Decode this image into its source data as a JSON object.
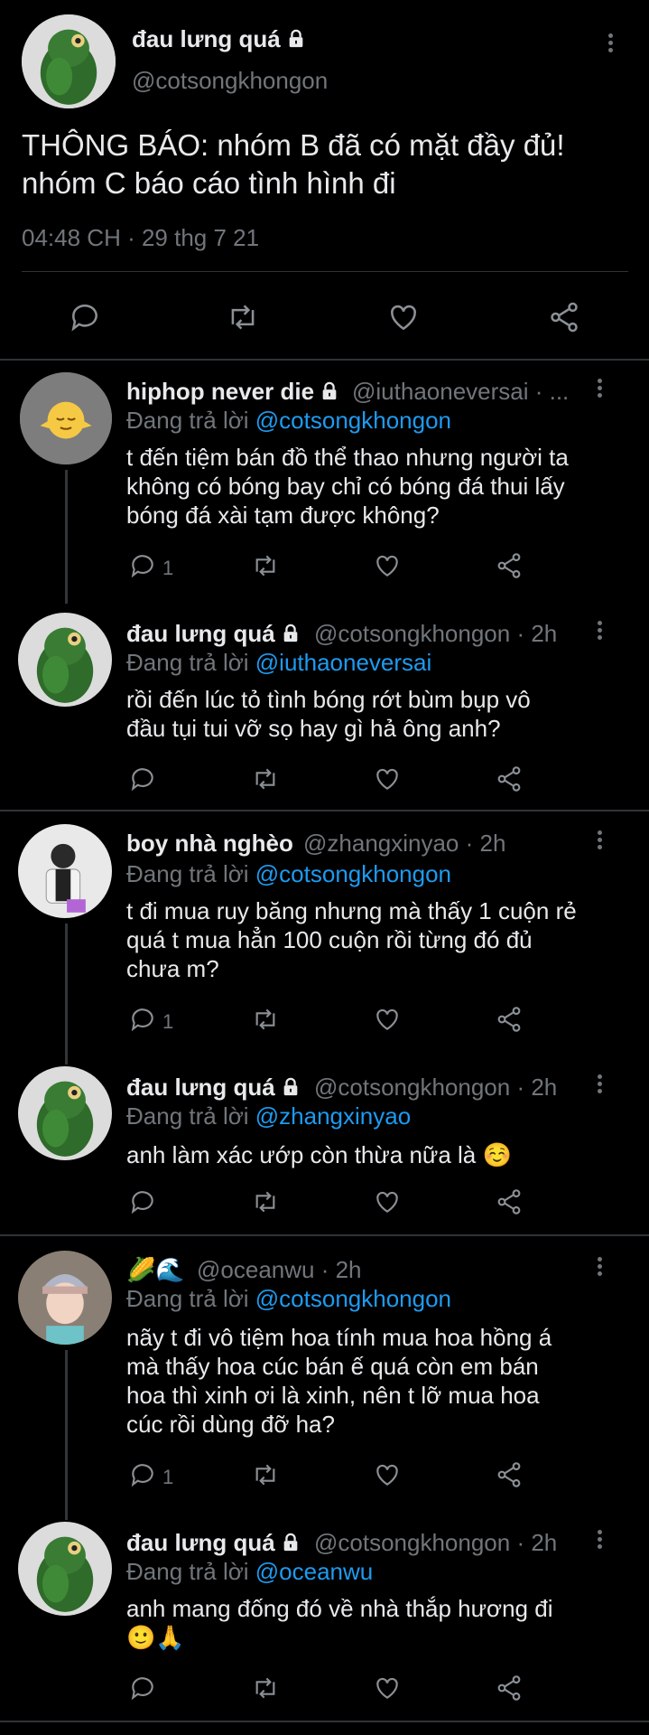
{
  "main": {
    "author_name": "đau lưng quá",
    "author_handle": "@cotsongkhongon",
    "text_line1": "THÔNG BÁO: nhóm B đã có mặt đầy đủ!",
    "text_line2": "nhóm C báo cáo tình hình đi",
    "timestamp": "04:48 CH · 29 thg 7 21"
  },
  "replies": [
    {
      "name": "hiphop never die",
      "handle": "@iuthaoneversai · ...",
      "replying_prefix": "Đang trả lời ",
      "replying_to": "@cotsongkhongon",
      "lines": [
        "t đến tiệm bán đồ thể thao nhưng người ta",
        "không có bóng bay chỉ có bóng đá thui lấy",
        "bóng đá xài tạm được không?"
      ],
      "reply_count": "1"
    },
    {
      "name": "đau lưng quá",
      "handle": "@cotsongkhongon · 2h",
      "replying_prefix": "Đang trả lời ",
      "replying_to": "@iuthaoneversai",
      "lines": [
        "rồi đến lúc tỏ tình bóng rớt bùm bụp vô",
        "đầu tụi tui vỡ sọ hay gì hả ông anh?"
      ],
      "reply_count": ""
    },
    {
      "name": "boy nhà nghèo",
      "handle": "@zhangxinyao · 2h",
      "replying_prefix": "Đang trả lời ",
      "replying_to": "@cotsongkhongon",
      "lines": [
        "t đi mua ruy băng nhưng mà thấy 1 cuộn rẻ",
        "quá t mua hẳn 100 cuộn rồi từng đó đủ",
        "chưa m?"
      ],
      "reply_count": "1"
    },
    {
      "name": "đau lưng quá",
      "handle": "@cotsongkhongon · 2h",
      "replying_prefix": "Đang trả lời ",
      "replying_to": "@zhangxinyao",
      "lines": [
        "anh làm xác ướp còn thừa nữa là ☺️"
      ],
      "reply_count": ""
    },
    {
      "name": "🌽🌊",
      "handle": "@oceanwu · 2h",
      "replying_prefix": "Đang trả lời ",
      "replying_to": "@cotsongkhongon",
      "lines": [
        "nãy t đi vô tiệm hoa tính mua hoa hồng á",
        "mà thấy hoa cúc bán ế quá còn em bán",
        "hoa thì xinh ơi là xinh, nên t lỡ mua hoa",
        "cúc rồi dùng đỡ ha?"
      ],
      "reply_count": "1"
    },
    {
      "name": "đau lưng quá",
      "handle": "@cotsongkhongon · 2h",
      "replying_prefix": "Đang trả lời ",
      "replying_to": "@oceanwu",
      "lines": [
        "anh mang đống đó về nhà thắp hương đi",
        "🙂🙏"
      ],
      "reply_count": ""
    }
  ],
  "colors": {
    "background": "#000000",
    "text": "#e7e9ea",
    "muted": "#71767b",
    "link": "#1d9bf0",
    "separator": "#2f3336"
  },
  "icons": [
    "lock-icon",
    "more-vertical-icon",
    "reply-icon",
    "retweet-icon",
    "like-icon",
    "share-icon"
  ]
}
